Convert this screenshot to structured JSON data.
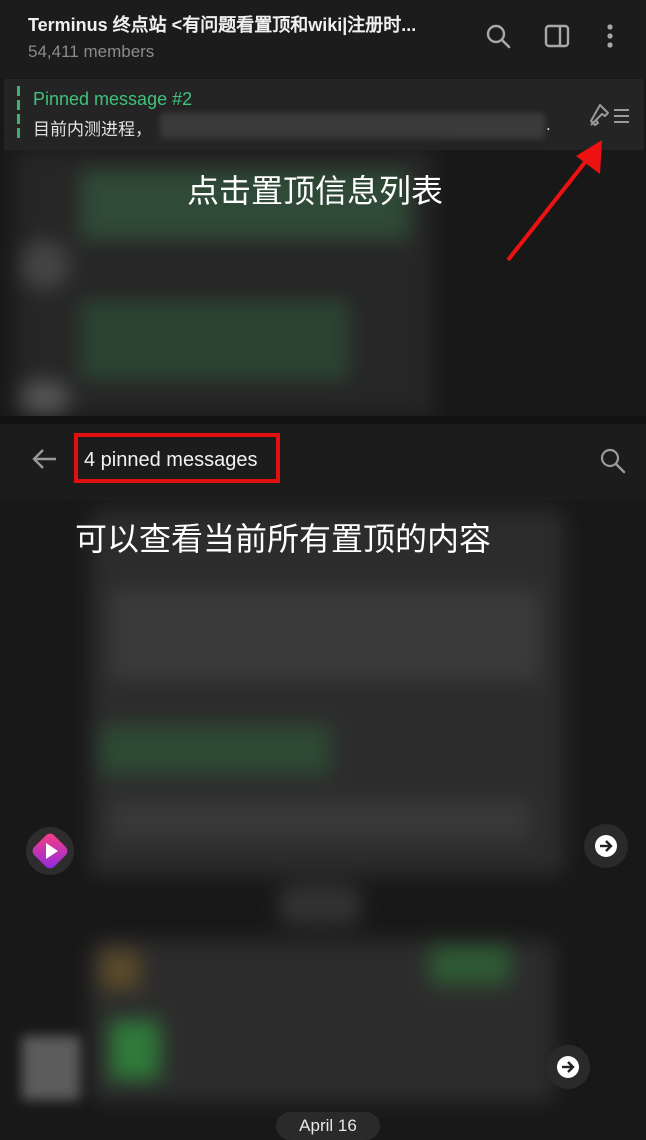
{
  "header": {
    "title": "Terminus 终点站 <有问题看置顶和wiki|注册时...",
    "members": "54,411 members"
  },
  "pinned": {
    "title": "Pinned message #2",
    "text": "目前内测进程，",
    "tail": "."
  },
  "annotations": {
    "top": "点击置顶信息列表",
    "bottom": "可以查看当前所有置顶的内容"
  },
  "pinned_panel": {
    "title": "4 pinned messages"
  },
  "date_pill": "April 16",
  "colors": {
    "accent_green": "#3fc27a",
    "highlight_red": "#e01010",
    "background": "#181818"
  }
}
